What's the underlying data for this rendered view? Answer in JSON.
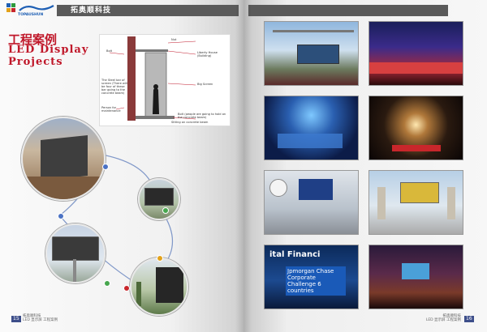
{
  "header": {
    "brand_name": "拓奥顺科技",
    "logo_text": "TOPAUSHUN"
  },
  "left_page": {
    "title_zh": "工程案例",
    "title_en_line1": "LED Display",
    "title_en_line2": "Projects",
    "diagram": {
      "label_nut": "Nut",
      "label_bolt": "Bolt",
      "label_house": "Liberty House (Building)",
      "label_steel": "The Steel bar of screen (There will be four of these bar going to the concrete beam)",
      "label_screen": "Big Screen",
      "label_person": "Person for maintenance",
      "label_beam": "Bolt (people are going to hold on the concrete beam)",
      "label_sitting": "Sitting on concrete beam"
    },
    "footer_line1": "拓奥顺科技",
    "footer_line2": "LED 显示屏 工程案例",
    "page_number": "15"
  },
  "right_page": {
    "photo_billboard_text": "Jpmorgan Chase Corporate Challenge 6 countries",
    "photo_building_sign": "ital Financi",
    "footer_line1": "拓奥顺科技",
    "footer_line2": "LED 显示屏 工程案例",
    "page_number": "16"
  },
  "colors": {
    "title_red": "#c0182a",
    "header_bar": "#5a5a5a",
    "page_number_bg": "#3d4e8a"
  }
}
